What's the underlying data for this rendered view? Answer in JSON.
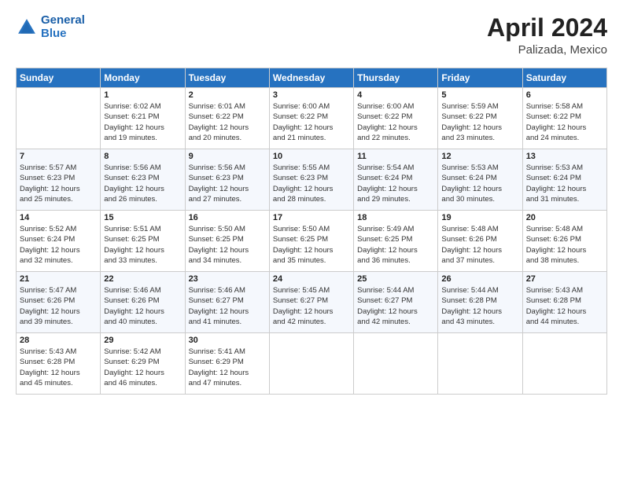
{
  "logo": {
    "line1": "General",
    "line2": "Blue"
  },
  "title": "April 2024",
  "location": "Palizada, Mexico",
  "days_header": [
    "Sunday",
    "Monday",
    "Tuesday",
    "Wednesday",
    "Thursday",
    "Friday",
    "Saturday"
  ],
  "weeks": [
    [
      {
        "day": "",
        "info": ""
      },
      {
        "day": "1",
        "info": "Sunrise: 6:02 AM\nSunset: 6:21 PM\nDaylight: 12 hours\nand 19 minutes."
      },
      {
        "day": "2",
        "info": "Sunrise: 6:01 AM\nSunset: 6:22 PM\nDaylight: 12 hours\nand 20 minutes."
      },
      {
        "day": "3",
        "info": "Sunrise: 6:00 AM\nSunset: 6:22 PM\nDaylight: 12 hours\nand 21 minutes."
      },
      {
        "day": "4",
        "info": "Sunrise: 6:00 AM\nSunset: 6:22 PM\nDaylight: 12 hours\nand 22 minutes."
      },
      {
        "day": "5",
        "info": "Sunrise: 5:59 AM\nSunset: 6:22 PM\nDaylight: 12 hours\nand 23 minutes."
      },
      {
        "day": "6",
        "info": "Sunrise: 5:58 AM\nSunset: 6:22 PM\nDaylight: 12 hours\nand 24 minutes."
      }
    ],
    [
      {
        "day": "7",
        "info": "Sunrise: 5:57 AM\nSunset: 6:23 PM\nDaylight: 12 hours\nand 25 minutes."
      },
      {
        "day": "8",
        "info": "Sunrise: 5:56 AM\nSunset: 6:23 PM\nDaylight: 12 hours\nand 26 minutes."
      },
      {
        "day": "9",
        "info": "Sunrise: 5:56 AM\nSunset: 6:23 PM\nDaylight: 12 hours\nand 27 minutes."
      },
      {
        "day": "10",
        "info": "Sunrise: 5:55 AM\nSunset: 6:23 PM\nDaylight: 12 hours\nand 28 minutes."
      },
      {
        "day": "11",
        "info": "Sunrise: 5:54 AM\nSunset: 6:24 PM\nDaylight: 12 hours\nand 29 minutes."
      },
      {
        "day": "12",
        "info": "Sunrise: 5:53 AM\nSunset: 6:24 PM\nDaylight: 12 hours\nand 30 minutes."
      },
      {
        "day": "13",
        "info": "Sunrise: 5:53 AM\nSunset: 6:24 PM\nDaylight: 12 hours\nand 31 minutes."
      }
    ],
    [
      {
        "day": "14",
        "info": "Sunrise: 5:52 AM\nSunset: 6:24 PM\nDaylight: 12 hours\nand 32 minutes."
      },
      {
        "day": "15",
        "info": "Sunrise: 5:51 AM\nSunset: 6:25 PM\nDaylight: 12 hours\nand 33 minutes."
      },
      {
        "day": "16",
        "info": "Sunrise: 5:50 AM\nSunset: 6:25 PM\nDaylight: 12 hours\nand 34 minutes."
      },
      {
        "day": "17",
        "info": "Sunrise: 5:50 AM\nSunset: 6:25 PM\nDaylight: 12 hours\nand 35 minutes."
      },
      {
        "day": "18",
        "info": "Sunrise: 5:49 AM\nSunset: 6:25 PM\nDaylight: 12 hours\nand 36 minutes."
      },
      {
        "day": "19",
        "info": "Sunrise: 5:48 AM\nSunset: 6:26 PM\nDaylight: 12 hours\nand 37 minutes."
      },
      {
        "day": "20",
        "info": "Sunrise: 5:48 AM\nSunset: 6:26 PM\nDaylight: 12 hours\nand 38 minutes."
      }
    ],
    [
      {
        "day": "21",
        "info": "Sunrise: 5:47 AM\nSunset: 6:26 PM\nDaylight: 12 hours\nand 39 minutes."
      },
      {
        "day": "22",
        "info": "Sunrise: 5:46 AM\nSunset: 6:26 PM\nDaylight: 12 hours\nand 40 minutes."
      },
      {
        "day": "23",
        "info": "Sunrise: 5:46 AM\nSunset: 6:27 PM\nDaylight: 12 hours\nand 41 minutes."
      },
      {
        "day": "24",
        "info": "Sunrise: 5:45 AM\nSunset: 6:27 PM\nDaylight: 12 hours\nand 42 minutes."
      },
      {
        "day": "25",
        "info": "Sunrise: 5:44 AM\nSunset: 6:27 PM\nDaylight: 12 hours\nand 42 minutes."
      },
      {
        "day": "26",
        "info": "Sunrise: 5:44 AM\nSunset: 6:28 PM\nDaylight: 12 hours\nand 43 minutes."
      },
      {
        "day": "27",
        "info": "Sunrise: 5:43 AM\nSunset: 6:28 PM\nDaylight: 12 hours\nand 44 minutes."
      }
    ],
    [
      {
        "day": "28",
        "info": "Sunrise: 5:43 AM\nSunset: 6:28 PM\nDaylight: 12 hours\nand 45 minutes."
      },
      {
        "day": "29",
        "info": "Sunrise: 5:42 AM\nSunset: 6:29 PM\nDaylight: 12 hours\nand 46 minutes."
      },
      {
        "day": "30",
        "info": "Sunrise: 5:41 AM\nSunset: 6:29 PM\nDaylight: 12 hours\nand 47 minutes."
      },
      {
        "day": "",
        "info": ""
      },
      {
        "day": "",
        "info": ""
      },
      {
        "day": "",
        "info": ""
      },
      {
        "day": "",
        "info": ""
      }
    ]
  ]
}
